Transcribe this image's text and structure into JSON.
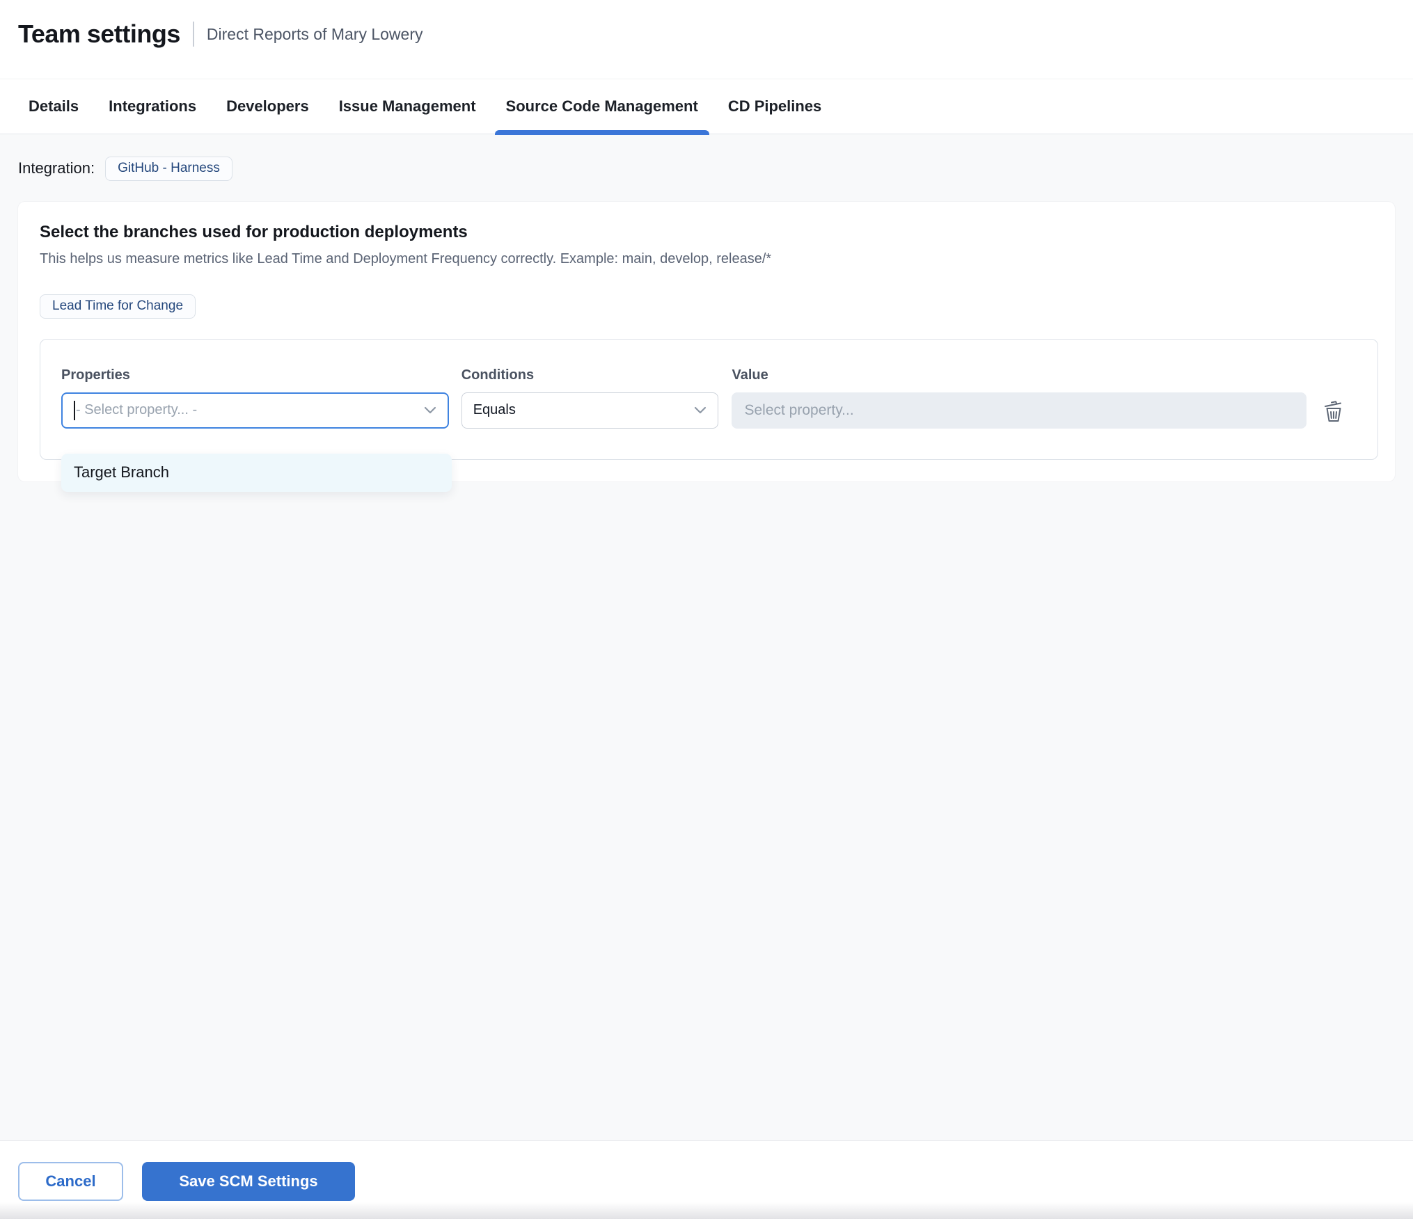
{
  "header": {
    "title": "Team settings",
    "subtitle": "Direct Reports of Mary Lowery"
  },
  "tabs": [
    {
      "label": "Details",
      "active": false
    },
    {
      "label": "Integrations",
      "active": false
    },
    {
      "label": "Developers",
      "active": false
    },
    {
      "label": "Issue Management",
      "active": false
    },
    {
      "label": "Source Code Management",
      "active": true
    },
    {
      "label": "CD Pipelines",
      "active": false
    }
  ],
  "integration": {
    "label": "Integration:",
    "chip": "GitHub - Harness"
  },
  "card": {
    "heading": "Select the branches used for production deployments",
    "description": "This helps us measure metrics like Lead Time and Deployment Frequency correctly. Example: main, develop, release/*",
    "metric_chip": "Lead Time for Change"
  },
  "filter": {
    "properties_label": "Properties",
    "conditions_label": "Conditions",
    "value_label": "Value",
    "property_placeholder": "- Select property... -",
    "condition_value": "Equals",
    "value_placeholder": "Select property...",
    "dropdown_options": [
      "Target Branch"
    ]
  },
  "footer": {
    "cancel_label": "Cancel",
    "save_label": "Save SCM Settings"
  },
  "colors": {
    "primary_blue": "#3673cf",
    "tab_underline_blue": "#3b76d8",
    "focus_border_blue": "#3f83e0",
    "chip_text_navy": "#24477c",
    "content_background": "#f8f9fa",
    "disabled_input_background": "#e9edf2",
    "dropdown_background": "#eef8fc",
    "cancel_text_blue": "#2d6bc9"
  }
}
